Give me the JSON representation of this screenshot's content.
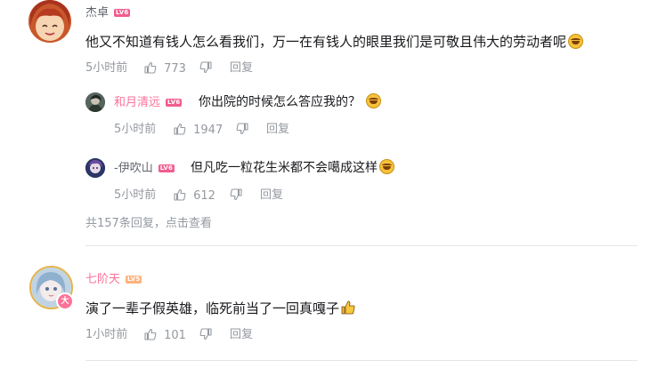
{
  "comments": [
    {
      "user": "杰卓",
      "level": "LV6",
      "text": "他又不知道有钱人怎么看我们，万一在有钱人的眼里我们是可敬且伟大的劳动者呢",
      "time": "5小时前",
      "likes": "773",
      "reply_label": "回复"
    },
    {
      "user": "七阶天",
      "level": "LV5",
      "text": "演了一辈子假英雄，临死前当了一回真嘎子",
      "time": "1小时前",
      "likes": "101",
      "reply_label": "回复"
    }
  ],
  "replies": [
    {
      "user": "和月清远",
      "level": "LV6",
      "text": "你出院的时候怎么答应我的？",
      "time": "5小时前",
      "likes": "1947",
      "reply_label": "回复"
    },
    {
      "user": "-伊吹山",
      "level": "LV6",
      "text": "但凡吃一粒花生米都不会噶成这样",
      "time": "5小时前",
      "likes": "612",
      "reply_label": "回复"
    }
  ],
  "reply_summary": {
    "count_text": "共157条回复，",
    "link_text": "点击查看"
  },
  "badge_text": "大",
  "colors": {
    "lv6": "#f25d8e",
    "lv5": "#ffb37c",
    "pink_name": "#fb7299",
    "badge": "#fb7299",
    "avatar_border_gold": "#e6b34a"
  }
}
